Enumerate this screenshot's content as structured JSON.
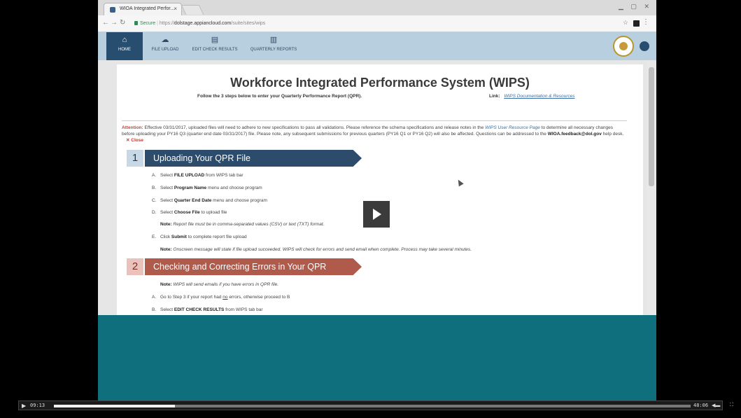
{
  "browser": {
    "tab_title": "WIOA Integrated Perfor...",
    "tab_close": "×",
    "secure_label": "Secure",
    "url_prefix": "https://",
    "url_host": "dolstage.appiancloud.com",
    "url_path": "/suite/sites/wips"
  },
  "appnav": {
    "items": [
      {
        "label": "HOME",
        "icon": "house-icon"
      },
      {
        "label": "FILE UPLOAD",
        "icon": "cloud-upload-icon"
      },
      {
        "label": "EDIT CHECK RESULTS",
        "icon": "document-icon"
      },
      {
        "label": "QUARTERLY REPORTS",
        "icon": "bar-chart-icon"
      }
    ]
  },
  "page": {
    "title": "Workforce Integrated Performance System (WIPS)",
    "subtitle": "Follow the 3 steps below to enter your Quarterly Performance Report (QPR).",
    "link_label": "Link:",
    "link_text": "WIPS Documentation & Resources"
  },
  "attention": {
    "label": "Attention:",
    "text1": "Effective 03/31/2017, uploaded files will need to adhere to new specifications to pass all validations. Please reference the schema specifications and release notes in the",
    "link": "WIPS User Resource Page",
    "text2": "to determine all necessary changes before uploading your PY16 Q3 (quarter end date 03/31/2017) file. Please note, any subsequent submissions for previous quarters (PY16 Q1 or PY16 Q2) will also be affected. Questions can be addressed to the",
    "email": "WIOA.feedback@dol.gov",
    "text3": "help desk.",
    "close": "✕ Close"
  },
  "section1": {
    "number": "1",
    "title": "Uploading Your QPR File",
    "steps": [
      {
        "letter": "A.",
        "pre": "Select",
        "bold": "FILE UPLOAD",
        "post": "from WIPS tab bar"
      },
      {
        "letter": "B.",
        "pre": "Select",
        "bold": "Program Name",
        "post": "menu and choose program"
      },
      {
        "letter": "C.",
        "pre": "Select",
        "bold": "Quarter End Date",
        "post": "menu and choose program"
      },
      {
        "letter": "D.",
        "pre": "Select",
        "bold": "Choose File",
        "post": "to upload file"
      },
      {
        "letter": "E.",
        "pre": "Click",
        "bold": "Submit",
        "post": "to complete report file upload"
      }
    ],
    "note_label": "Note:",
    "note_d": "Report file must be in comma-separated values (CSV) or text (TXT) format.",
    "note_e": "Onscreen message will state if file upload succeeded. WIPS will check for errors and send email when complete. Process may take several minutes."
  },
  "section2": {
    "number": "2",
    "title": "Checking and Correcting Errors in Your QPR",
    "note_label": "Note:",
    "note": "WIPS will send emails if you have errors in QPR file.",
    "step_a": {
      "letter": "A.",
      "pre": "Go to Step 3 if your report had",
      "under": "no",
      "post": "errors, otherwise proceed to B"
    },
    "step_b": {
      "letter": "B.",
      "pre": "Select",
      "bold": "EDIT CHECK RESULTS",
      "post": "from WIPS tab bar"
    }
  },
  "video": {
    "elapsed": "09:13",
    "duration": "48:06",
    "progress_fraction": 0.19
  }
}
